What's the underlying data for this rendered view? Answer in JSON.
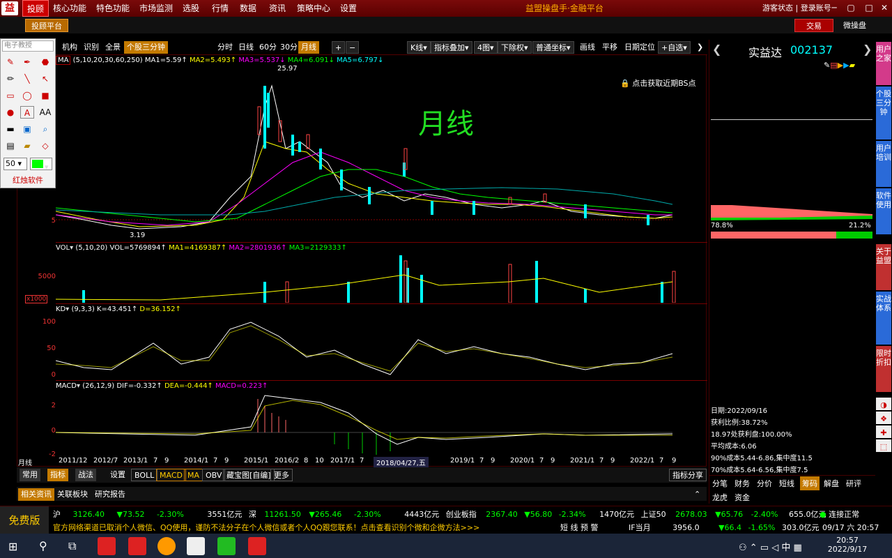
{
  "app_title": "益盟操盘手·金融平台",
  "menu": [
    "投顾",
    "核心功能",
    "特色功能",
    "市场监测",
    "选股",
    "行情",
    "数据",
    "资讯",
    "策略中心",
    "设置"
  ],
  "top_right": {
    "guest": "游客状态",
    "login": "登录账号"
  },
  "bar2": {
    "platform": "投顾平台",
    "trade": "交易",
    "micro": "微操盘"
  },
  "drawtools": {
    "search_placeholder": "电子教授",
    "size": "50",
    "brand": "红烛软件"
  },
  "toolbar": {
    "left": [
      "机构",
      "识别",
      "全景",
      "个股三分钟"
    ],
    "periods": [
      "分时",
      "日线",
      "60分",
      "30分",
      "月线"
    ],
    "right": [
      "K线",
      "指标叠加",
      "4图",
      "下除权",
      "普通坐标",
      "画线",
      "平移",
      "日期定位",
      "+自选"
    ]
  },
  "main_pane": {
    "ma_indicator": "MA",
    "ma_params": "(5,10,20,30,60,250)",
    "ma1": "MA1=5.59↑",
    "ma2": "MA2=5.493↑",
    "ma3": "MA3=5.537↓",
    "ma4": "MA4=6.091↓",
    "ma5": "MA5=6.797↓",
    "high_label": "25.97",
    "low_label": "3.19",
    "y_tick": "5",
    "bs_hint": "点击获取近期BS点",
    "overlay_text": "月线"
  },
  "vol_pane": {
    "name": "VOL",
    "params": "(5,10,20)",
    "vol": "VOL=5769894↑",
    "ma1": "MA1=4169387↑",
    "ma2": "MA2=2801936↑",
    "ma3": "MA3=2129333↑",
    "y_tick": "5000",
    "unit": "x1000"
  },
  "kd_pane": {
    "name": "KD",
    "params": "(9,3,3)",
    "k": "K=43.451↑",
    "d": "D=36.152↑",
    "y_ticks": [
      "100",
      "50",
      "0"
    ]
  },
  "macd_pane": {
    "name": "MACD",
    "params": "(26,12,9)",
    "dif": "DIF=-0.332↑",
    "dea": "DEA=-0.444↑",
    "macd": "MACD=0.223↑",
    "y_ticks": [
      "2",
      "0",
      "-2"
    ]
  },
  "xaxis": {
    "period": "月线",
    "labels": [
      "2011/12",
      "2012/7",
      "2013/1",
      "7",
      "9",
      "2014/1",
      "7",
      "9",
      "2015/1",
      "2016/2",
      "8",
      "10",
      "2017/1",
      "7",
      "2018/04/27,五",
      "2019/1",
      "7",
      "9",
      "2020/1",
      "7",
      "9",
      "2021/1",
      "7",
      "9",
      "2022/1",
      "7",
      "9"
    ]
  },
  "bottom_tabs": [
    "常用",
    "指标",
    "战法",
    "设置",
    "BOLL",
    "MACD",
    "MA",
    "OBV",
    "藏宝图[自编]",
    "更多",
    "指标分享"
  ],
  "info_tabs": [
    "相关资讯",
    "关联板块",
    "研究报告"
  ],
  "stock": {
    "name": "实益达",
    "code": "002137"
  },
  "chip": {
    "left_pct": "78.8%",
    "right_pct": "21.2%",
    "date": "日期:2022/09/16",
    "profit_ratio": "获利比例:38.72%",
    "line3": "18.97处获利盘:100.00%",
    "avg_cost": "平均成本:6.06",
    "c90": "90%成本5.44-6.86,集中度11.5",
    "c70": "70%成本5.64-6.56,集中度7.5"
  },
  "right_tabs": [
    "分笔",
    "财务",
    "分价",
    "短线",
    "筹码",
    "解盘",
    "研评"
  ],
  "right_tabs2": [
    "龙虎",
    "资金"
  ],
  "sidebar": [
    "用户之家",
    "个股三分钟",
    "用户培训",
    "软件使用",
    "关于益盟",
    "实战体系",
    "限时折扣"
  ],
  "ticker": {
    "row1": [
      {
        "name": "沪",
        "val": "3126.40",
        "chg": "▼73.52",
        "pct": "-2.30%",
        "amt": "3551亿元"
      },
      {
        "name": "深",
        "val": "11261.50",
        "chg": "▼265.46",
        "pct": "-2.30%",
        "amt": "4443亿元"
      },
      {
        "name": "创业板指",
        "val": "2367.40",
        "chg": "▼56.80",
        "pct": "-2.34%",
        "amt": "1470亿元"
      },
      {
        "name": "上证50",
        "val": "2678.03",
        "chg": "▼65.76",
        "pct": "-2.40%",
        "amt": "655.0亿元"
      }
    ],
    "connected": "连接正常",
    "free": "免费版",
    "notice": "官方网络渠道已取消个人微信、QQ使用，谨防不法分子在个人微信或者个人QQ跟您联系！点击查看识别个微和企微方法>>>",
    "short_alert": "短 线 预 警",
    "if_name": "IF当月",
    "if_val": "3956.0",
    "if_chg": "▼66.4",
    "if_pct": "-1.65%",
    "if_amt": "303.0亿元",
    "date": "09/17 六",
    "time": "20:57"
  },
  "taskbar": {
    "time": "20:57",
    "date": "2022/9/17",
    "ime": "中"
  },
  "chart_data": {
    "type": "line",
    "x_start": "2011/12",
    "x_end": "2022/9",
    "main_high": 25.97,
    "main_low": 3.19,
    "kd_k": 43.451,
    "kd_d": 36.152,
    "macd_dif": -0.332,
    "macd_dea": -0.444,
    "macd": 0.223
  }
}
